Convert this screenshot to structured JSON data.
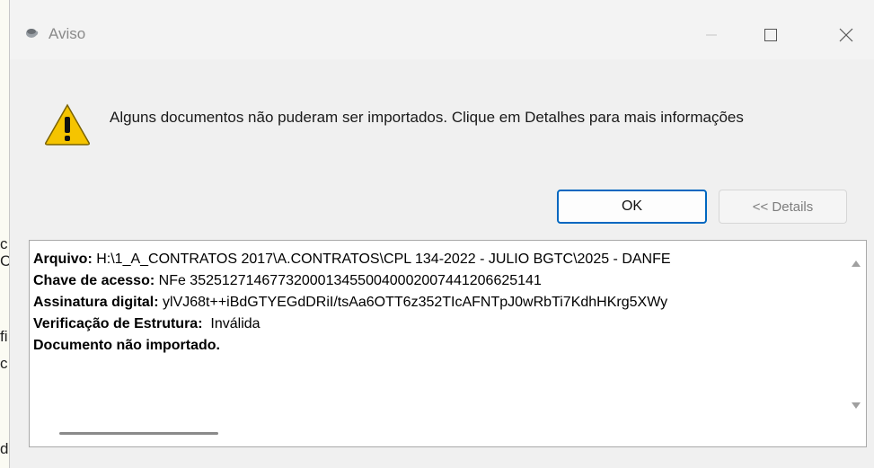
{
  "background": {
    "letters": [
      "c",
      "C",
      "fi",
      "c",
      "d"
    ]
  },
  "window": {
    "title": "Aviso",
    "icon": "java-cup-icon",
    "controls": {
      "minimize": "minimize-icon",
      "maximize": "maximize-icon",
      "close": "close-icon"
    }
  },
  "dialog": {
    "icon": "warning-icon",
    "message": "Alguns documentos não puderam ser importados. Clique em Detalhes para mais informações",
    "ok_label": "OK",
    "details_label": "<< Details"
  },
  "details": {
    "lines": [
      {
        "label": "Arquivo:",
        "value": " H:\\1_A_CONTRATOS 2017\\A.CONTRATOS\\CPL 134-2022 - JULIO BGTC\\2025 - DANFE"
      },
      {
        "label": "Chave de acesso:",
        "value": " NFe 35251271467732000134550040002007441206625141"
      },
      {
        "label": "Assinatura digital:",
        "value": " ylVJ68t++iBdGTYEGdDRiI/tsAa6OTT6z352TIcAFNTpJ0wRbTi7KdhHKrg5XWy"
      },
      {
        "label": "Verificação de Estrutura:",
        "value": "  Inválida"
      },
      {
        "label": "Documento não importado.",
        "value": ""
      }
    ]
  },
  "colors": {
    "accent": "#0067c0",
    "warning": "#f5c400"
  }
}
